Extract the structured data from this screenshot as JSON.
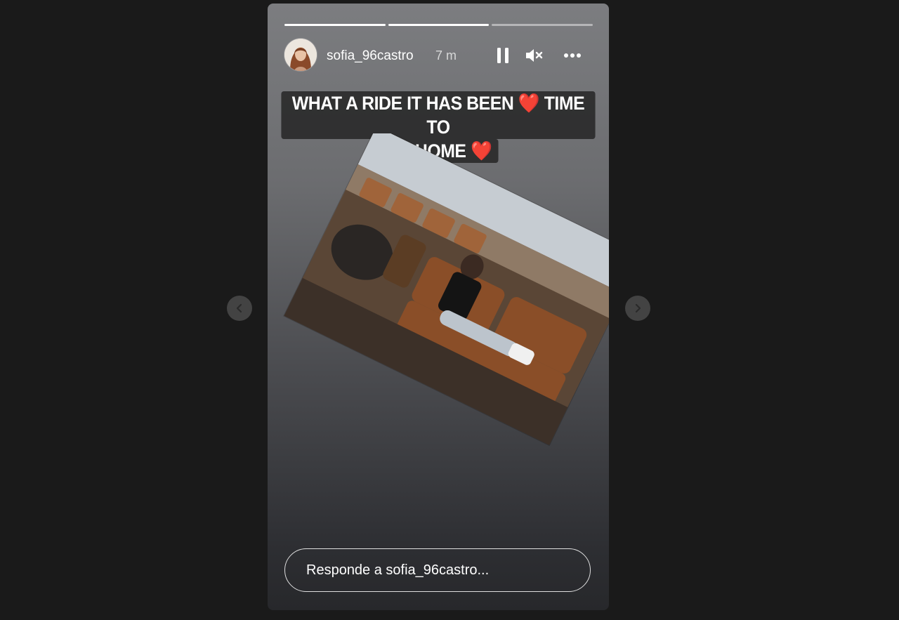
{
  "story": {
    "progress": {
      "total_segments": 3,
      "completed_segments": 2,
      "current_progress": 0.0
    },
    "header": {
      "username": "sofia_96castro",
      "timestamp": "7 m",
      "pause_icon": "pause-icon",
      "mute_icon": "speaker-muted-icon",
      "more_icon": "more-horizontal-icon"
    },
    "caption": {
      "line1": "WHAT A RIDE IT HAS BEEN ❤️ TIME TO",
      "line2": "GO HOME ❤️"
    },
    "reply": {
      "placeholder": "Responde a sofia_96castro..."
    }
  },
  "navigation": {
    "prev_icon": "chevron-left-icon",
    "next_icon": "chevron-right-icon"
  },
  "colors": {
    "background": "#1a1a1a",
    "text": "#ffffff"
  }
}
